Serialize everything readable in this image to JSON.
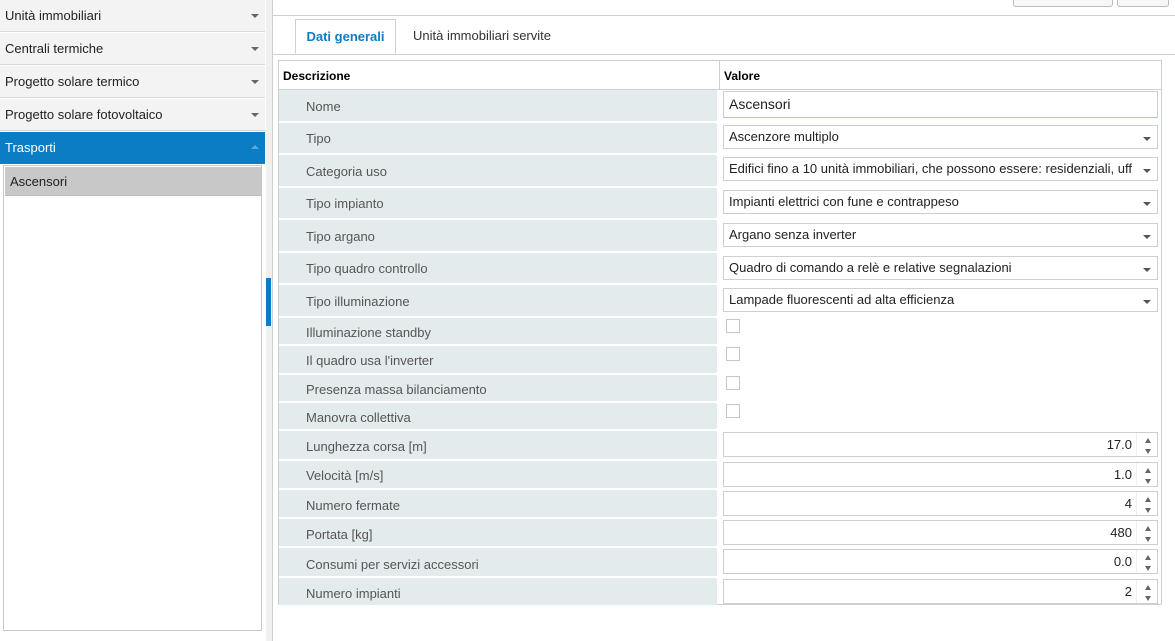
{
  "sidebar": {
    "items": [
      {
        "label": "Unità immobiliari"
      },
      {
        "label": "Centrali termiche"
      },
      {
        "label": "Progetto solare termico"
      },
      {
        "label": "Progetto solare fotovoltaico"
      },
      {
        "label": "Trasporti"
      }
    ],
    "active_sub_item": "Ascensori"
  },
  "tabs": {
    "general": "Dati generali",
    "units": "Unità immobiliari servite"
  },
  "grid": {
    "header_desc": "Descrizione",
    "header_value": "Valore",
    "rows": [
      {
        "label": "Nome",
        "value": "Ascensori"
      },
      {
        "label": "Tipo",
        "value": "Ascenzore multiplo"
      },
      {
        "label": "Categoria uso",
        "value": "Edifici fino a 10 unità immobiliari, che possono essere: residenziali, uff"
      },
      {
        "label": "Tipo impianto",
        "value": "Impianti elettrici con fune e contrappeso"
      },
      {
        "label": "Tipo argano",
        "value": "Argano senza inverter"
      },
      {
        "label": "Tipo quadro controllo",
        "value": "Quadro di comando a relè e relative segnalazioni"
      },
      {
        "label": "Tipo illuminazione",
        "value": "Lampade fluorescenti ad alta efficienza"
      },
      {
        "label": "Illuminazione standby",
        "checked": false
      },
      {
        "label": "Il quadro usa l'inverter",
        "checked": false
      },
      {
        "label": "Presenza massa bilanciamento",
        "checked": false
      },
      {
        "label": "Manovra collettiva",
        "checked": false
      },
      {
        "label": "Lunghezza corsa [m]",
        "value": "17.0"
      },
      {
        "label": "Velocità [m/s]",
        "value": "1.0"
      },
      {
        "label": "Numero fermate",
        "value": "4"
      },
      {
        "label": "Portata [kg]",
        "value": "480"
      },
      {
        "label": "Consumi per servizi accessori",
        "value": "0.0"
      },
      {
        "label": "Numero impianti",
        "value": "2"
      }
    ]
  },
  "colors": {
    "accent": "#0b7dc5",
    "desc_bg": "#e4ebec"
  }
}
